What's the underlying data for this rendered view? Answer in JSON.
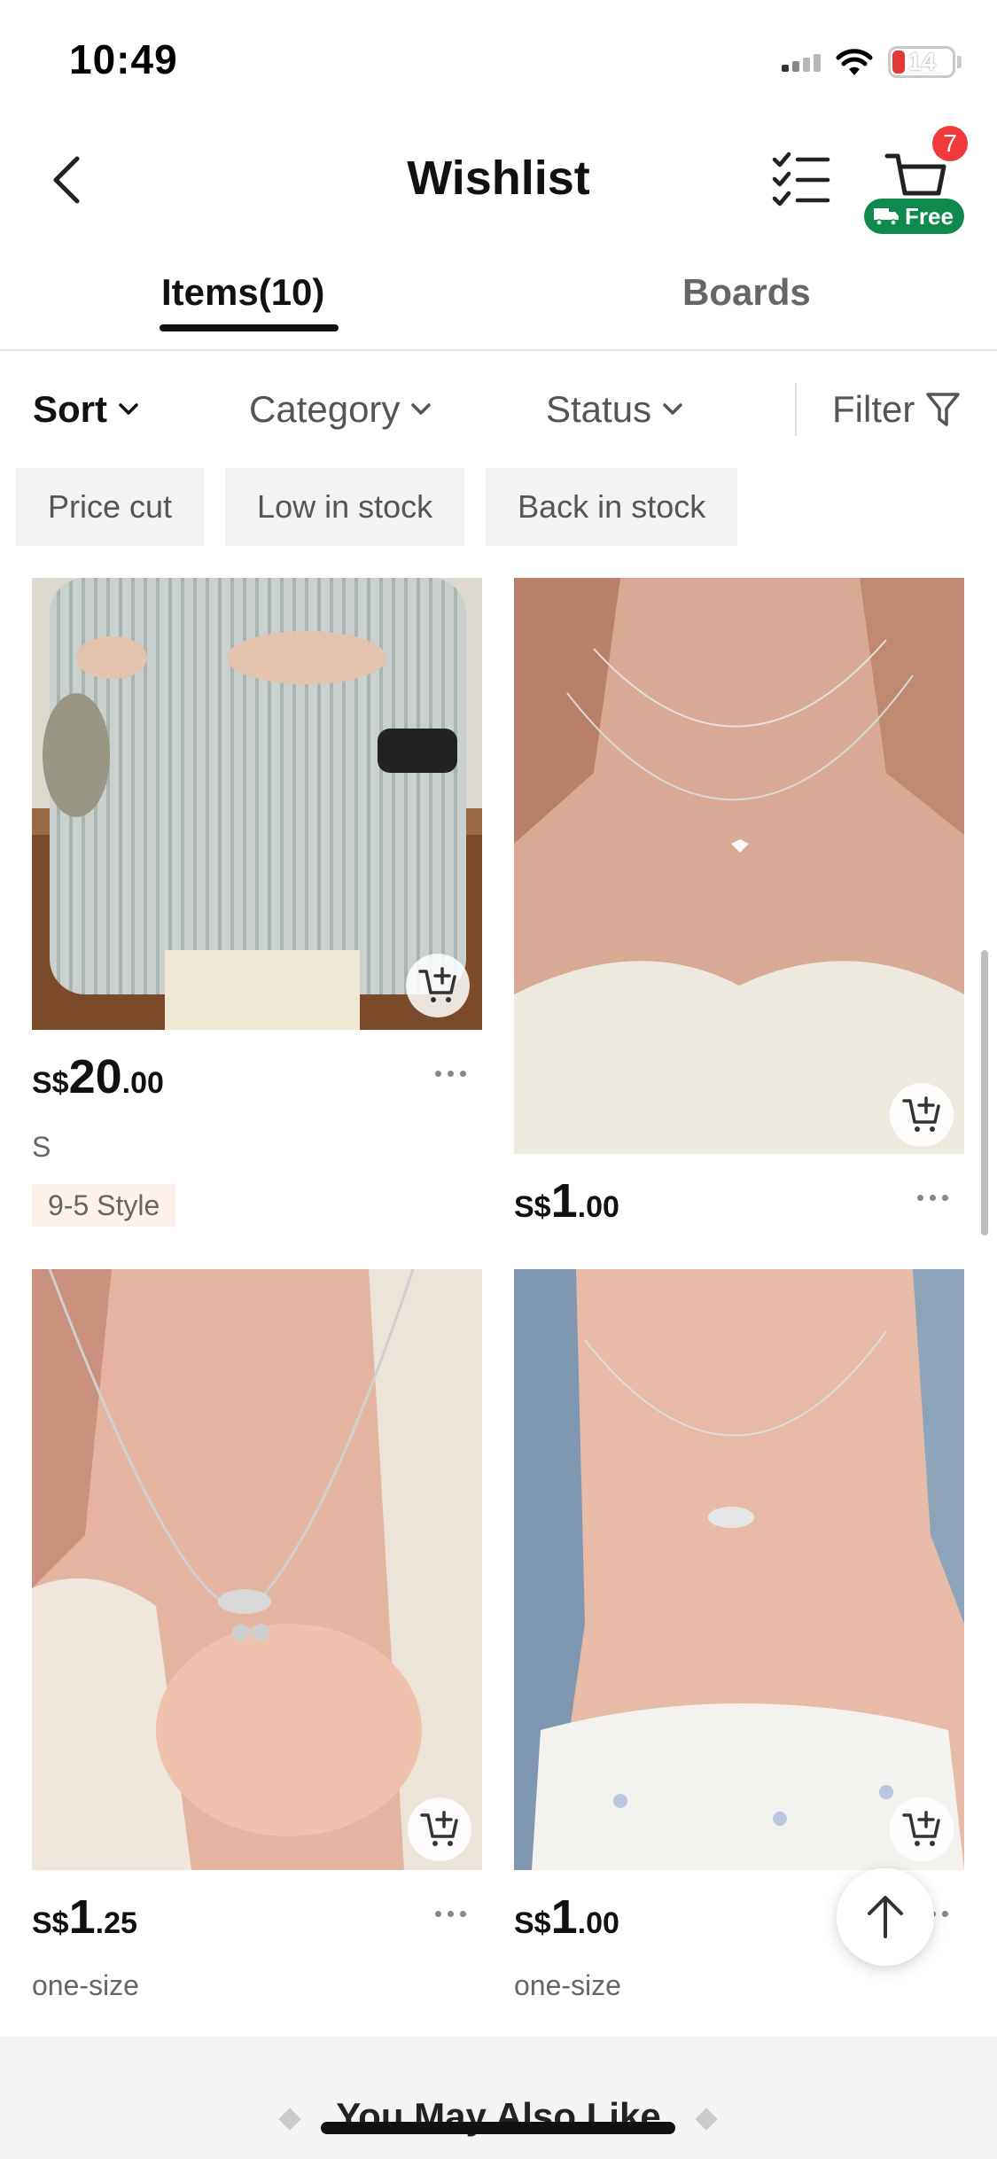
{
  "status_bar": {
    "time": "10:49",
    "battery": "14"
  },
  "header": {
    "title": "Wishlist",
    "cart_count": "7",
    "free_label": "Free"
  },
  "tabs": [
    {
      "label": "Items(10)"
    },
    {
      "label": "Boards"
    }
  ],
  "sortbar": {
    "sort": "Sort",
    "category": "Category",
    "status": "Status",
    "filter": "Filter"
  },
  "chips": [
    {
      "label": "Price cut"
    },
    {
      "label": "Low in stock"
    },
    {
      "label": "Back in stock"
    }
  ],
  "products": [
    {
      "currency": "S$",
      "price_int": "20",
      "price_dec": ".00",
      "attr": "S",
      "tag": "9-5 Style"
    },
    {
      "currency": "S$",
      "price_int": "1",
      "price_dec": ".00"
    },
    {
      "currency": "S$",
      "price_int": "1",
      "price_dec": ".25",
      "attr": "one-size"
    },
    {
      "currency": "S$",
      "price_int": "1",
      "price_dec": ".00",
      "attr": "one-size"
    }
  ],
  "recommendations": {
    "title": "You May Also Like"
  }
}
